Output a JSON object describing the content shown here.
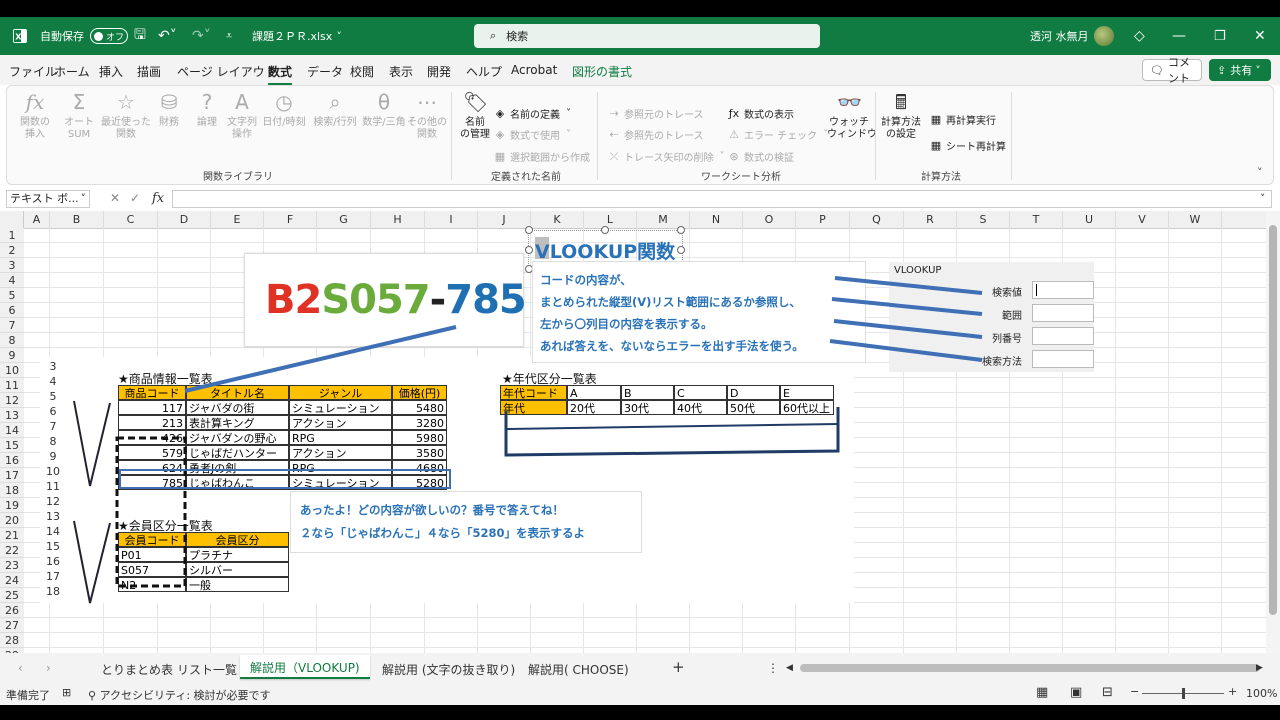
{
  "titlebar": {
    "autosave_label": "自動保存",
    "autosave_state": "オフ",
    "filename": "課題２ＰＲ.xlsx",
    "search_placeholder": "検索",
    "user_name": "透河 水無月"
  },
  "menu": {
    "tabs": [
      "ファイル",
      "ホーム",
      "挿入",
      "描画",
      "ページ レイアウト",
      "数式",
      "データ",
      "校閲",
      "表示",
      "開発",
      "ヘルプ",
      "Acrobat",
      "図形の書式"
    ],
    "active": "数式",
    "comment_label": "コメント",
    "share_label": "共有"
  },
  "ribbon": {
    "func_lib": {
      "insert": "関数の\n挿入",
      "autosum": "オート\nSUM",
      "recent": "最近使った\n関数",
      "financial": "財務",
      "logical": "論理",
      "text": "文字列\n操作",
      "datetime": "日付/時刻",
      "lookup": "検索/行列",
      "math": "数学/三角",
      "more": "その他の\n関数",
      "group_label": "関数ライブラリ"
    },
    "names": {
      "manager": "名前\nの管理",
      "define": "名前の定義",
      "use_in_formula": "数式で使用",
      "create_from_selection": "選択範囲から作成",
      "group_label": "定義された名前"
    },
    "audit": {
      "trace_precedents": "参照元のトレース",
      "trace_dependents": "参照先のトレース",
      "remove_arrows": "トレース矢印の削除",
      "show_formulas": "数式の表示",
      "error_check": "エラー チェック",
      "evaluate": "数式の検証",
      "watch": "ウォッチ\nウィンドウ",
      "group_label": "ワークシート分析"
    },
    "calc": {
      "options": "計算方法\nの設定",
      "calc_now": "再計算実行",
      "calc_sheet": "シート再計算",
      "group_label": "計算方法"
    }
  },
  "formula_bar": {
    "name_box": "テキスト ボ...",
    "fx": "fx"
  },
  "grid": {
    "columns": [
      "A",
      "B",
      "C",
      "D",
      "E",
      "F",
      "G",
      "H",
      "I",
      "J",
      "K",
      "L",
      "M",
      "N",
      "O",
      "P",
      "Q",
      "R",
      "S",
      "T",
      "U",
      "V",
      "W"
    ],
    "rows": [
      "1",
      "2",
      "3",
      "4",
      "5",
      "6",
      "7",
      "8",
      "9",
      "10",
      "11",
      "12",
      "13",
      "14",
      "15",
      "16",
      "17",
      "18",
      "19",
      "20",
      "21",
      "22",
      "23",
      "24",
      "25",
      "26",
      "27",
      "28",
      "29"
    ]
  },
  "embedded": {
    "code_banner": {
      "part1": "B2",
      "part2": "S057",
      "part3": "-",
      "part4": "785"
    },
    "vlookup_title": "VLOOKUP関数",
    "explain_lines": [
      "コードの内容が、",
      "まとめられた縦型(V)リスト範囲にあるか参照し、",
      "左から〇列目の内容を表示する。",
      "あれば答えを、ないならエラーを出す手法を使う。"
    ],
    "dialog": {
      "title": "VLOOKUP",
      "labels": [
        "検索値",
        "範囲",
        "列番号",
        "検索方法"
      ]
    },
    "product_table": {
      "title": "★商品情報一覧表",
      "headers": [
        "商品コード",
        "タイトル名",
        "ジャンル",
        "価格(円)"
      ],
      "rows": [
        [
          "117",
          "ジャバダの街",
          "シミュレーション",
          "5480"
        ],
        [
          "213",
          "表計算キング",
          "アクション",
          "3280"
        ],
        [
          "426",
          "ジャバダンの野心",
          "RPG",
          "5980"
        ],
        [
          "579",
          "じゃばだハンター",
          "アクション",
          "3580"
        ],
        [
          "624",
          "勇者Jの剣",
          "RPG",
          "4680"
        ],
        [
          "785",
          "じゃばわんこ",
          "シミュレーション",
          "5280"
        ]
      ],
      "inner_rows": [
        "3",
        "4",
        "5",
        "6",
        "7",
        "8",
        "9",
        "10",
        "11",
        "12",
        "13",
        "14",
        "15",
        "16",
        "17",
        "18"
      ]
    },
    "member_table": {
      "title": "★会員区分一覧表",
      "headers": [
        "会員コード",
        "会員区分"
      ],
      "rows": [
        [
          "P01",
          "プラチナ"
        ],
        [
          "S057",
          "シルバー"
        ],
        [
          "N2",
          "一般"
        ]
      ]
    },
    "era_table": {
      "title": "★年代区分一覧表",
      "row1": [
        "年代コード",
        "A",
        "B",
        "C",
        "D",
        "E"
      ],
      "row2": [
        "年代",
        "20代",
        "30代",
        "40代",
        "50代",
        "60代以上"
      ]
    },
    "callout": [
      "あったよ！どの内容が欲しいの？番号で答えてね！",
      "２なら「じゃばわんこ」４なら「5280」を表示するよ"
    ]
  },
  "sheet_tabs": [
    "とりまとめ表",
    "リスト一覧",
    "解説用（VLOOKUP)",
    "解説用 (文字の抜き取り)",
    "解説用( CHOOSE)"
  ],
  "active_sheet": "解説用（VLOOKUP)",
  "status": {
    "ready": "準備完了",
    "accessibility": "アクセシビリティ: 検討が必要です",
    "zoom": "100%"
  },
  "colors": {
    "excel_green": "#107c41",
    "header_yellow": "#ffc000",
    "line_blue": "#3f6fb5"
  }
}
